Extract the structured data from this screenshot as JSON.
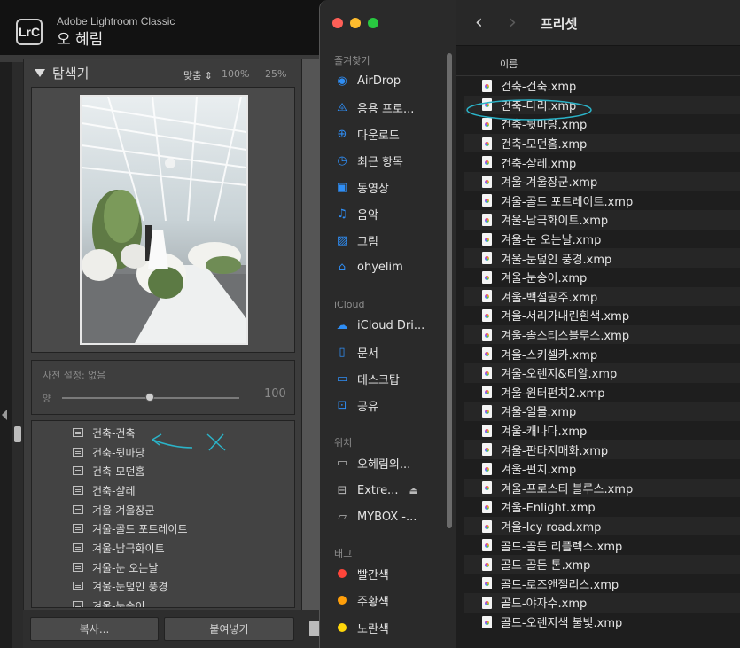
{
  "lightroom": {
    "logo": "LrC",
    "app_name": "Adobe Lightroom Classic",
    "user": "오 혜림",
    "navigator": {
      "title": "탐색기",
      "zoom_fit": "맞춤 ⇕",
      "zoom_100": "100%",
      "zoom_25": "25%"
    },
    "presets_panel": {
      "label": "사전 설정: 없음",
      "amount_label": "양",
      "amount_value": "100"
    },
    "preset_items": [
      "건축-건축",
      "건축-뒷마당",
      "건축-모던홈",
      "건축-샬레",
      "겨울-겨울장군",
      "겨울-골드 포트레이트",
      "겨울-남극화이트",
      "겨울-눈 오는날",
      "겨울-눈덮인 풍경",
      "겨울-눈송이"
    ],
    "buttons": {
      "copy": "복사...",
      "paste": "붙여넣기"
    }
  },
  "finder": {
    "title": "프리셋",
    "column_name": "이름",
    "sidebar": {
      "favorites_label": "즐겨찾기",
      "favorites": [
        {
          "icon": "airdrop-icon",
          "label": "AirDrop"
        },
        {
          "icon": "applications-icon",
          "label": "응용 프로..."
        },
        {
          "icon": "downloads-icon",
          "label": "다운로드"
        },
        {
          "icon": "recents-icon",
          "label": "최근 항목"
        },
        {
          "icon": "movies-icon",
          "label": "동영상"
        },
        {
          "icon": "music-icon",
          "label": "음악"
        },
        {
          "icon": "pictures-icon",
          "label": "그림"
        },
        {
          "icon": "home-icon",
          "label": "ohyelim"
        }
      ],
      "icloud_label": "iCloud",
      "icloud": [
        {
          "icon": "icloud-drive-icon",
          "label": "iCloud Dri..."
        },
        {
          "icon": "documents-icon",
          "label": "문서"
        },
        {
          "icon": "desktop-icon",
          "label": "데스크탑"
        },
        {
          "icon": "shared-folder-icon",
          "label": "공유"
        }
      ],
      "locations_label": "위치",
      "locations": [
        {
          "icon": "computer-icon",
          "label": "오혜림의..."
        },
        {
          "icon": "external-drive-icon",
          "label": "Extre..."
        },
        {
          "icon": "folder-icon",
          "label": "MYBOX -..."
        }
      ],
      "tags_label": "태그",
      "tags": [
        {
          "color": "#ff453a",
          "label": "빨간색"
        },
        {
          "color": "#ff9f0a",
          "label": "주황색"
        },
        {
          "color": "#ffd60a",
          "label": "노란색"
        }
      ]
    },
    "files": [
      "건축-건축.xmp",
      "건축-다리.xmp",
      "건축-뒷마당.xmp",
      "건축-모던홈.xmp",
      "건축-샬레.xmp",
      "겨울-겨울장군.xmp",
      "겨울-골드 포트레이트.xmp",
      "겨울-남극화이트.xmp",
      "겨울-눈 오는날.xmp",
      "겨울-눈덮인 풍경.xmp",
      "겨울-눈송이.xmp",
      "겨울-백설공주.xmp",
      "겨울-서리가내린흰색.xmp",
      "겨울-솔스티스블루스.xmp",
      "겨울-스키셀카.xmp",
      "겨울-오렌지&티알.xmp",
      "겨울-원터펀치2.xmp",
      "겨울-일몰.xmp",
      "겨울-캐나다.xmp",
      "겨울-판타지매화.xmp",
      "겨울-펀치.xmp",
      "겨울-프로스티 블루스.xmp",
      "겨울-Enlight.xmp",
      "겨울-Icy road.xmp",
      "골드-골든 리플렉스.xmp",
      "골드-골든 톤.xmp",
      "골드-로즈앤젤리스.xmp",
      "골드-야자수.xmp",
      "골드-오렌지색 불빛.xmp"
    ]
  }
}
